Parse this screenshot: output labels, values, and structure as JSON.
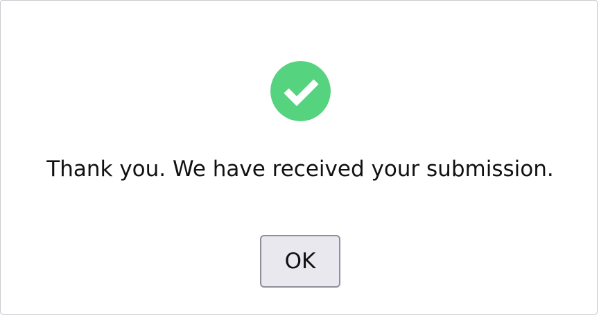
{
  "dialog": {
    "message": "Thank you. We have received your submission.",
    "ok_label": "OK",
    "icon": "checkmark-circle-icon",
    "colors": {
      "success": "#55d37f",
      "checkmark": "#ffffff",
      "button_background": "#e9e8ee",
      "button_border": "#8e8e9b",
      "text": "#111111"
    }
  }
}
